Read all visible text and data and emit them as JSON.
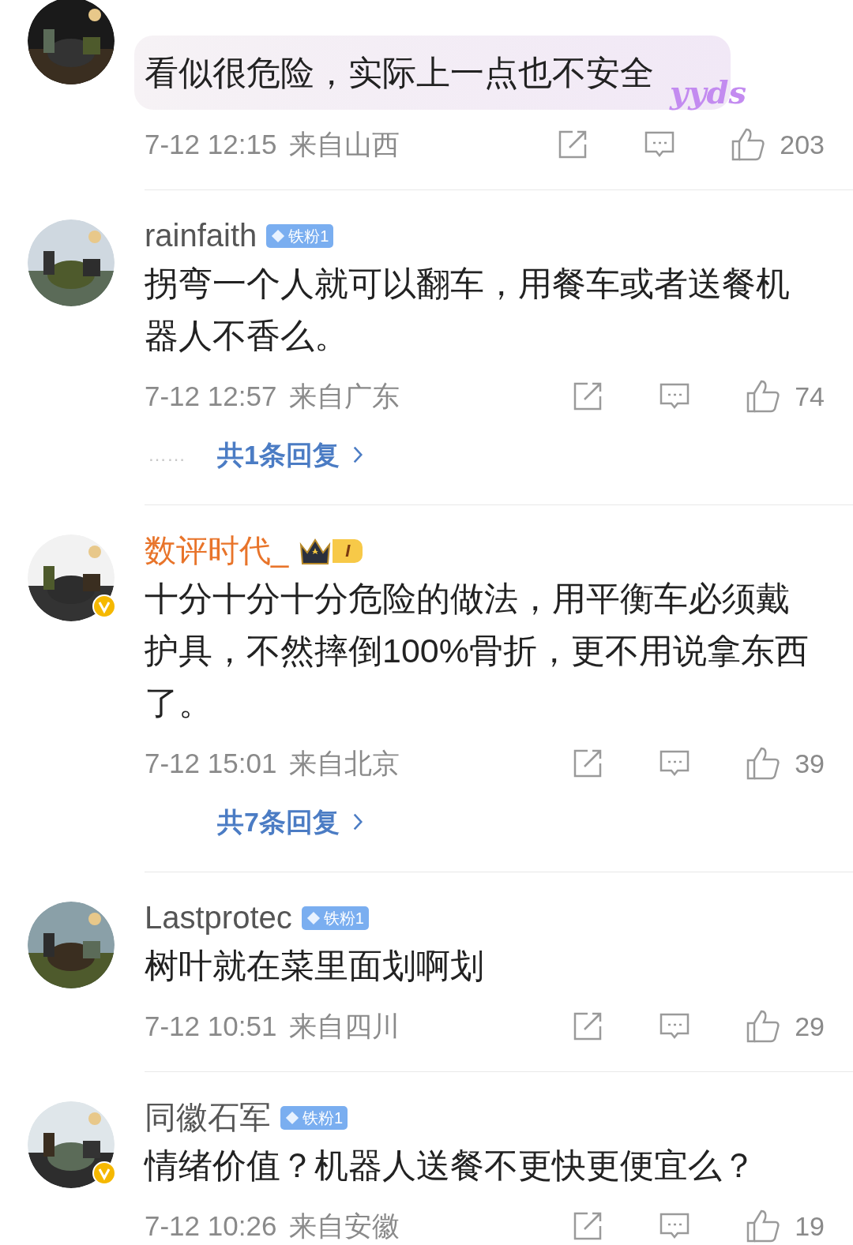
{
  "comments": [
    {
      "avatar": {
        "kind": "picture",
        "verified": false
      },
      "lines": [
        "看似很危险，实际上一点也不安全"
      ],
      "bubble": true,
      "sticker": "yyds",
      "time": "7-12 12:15",
      "location": "来自山西",
      "likes": "203"
    },
    {
      "avatar": {
        "kind": "picture",
        "verified": false
      },
      "name": "rainfaith",
      "vip": false,
      "badge": {
        "kind": "fan",
        "label": "铁粉1"
      },
      "lines": [
        "拐弯一个人就可以翻车，用餐车或者送餐机",
        "器人不香么。"
      ],
      "bubble": false,
      "time": "7-12 12:57",
      "location": "来自广东",
      "likes": "74",
      "replies": {
        "dots": "……",
        "label": "共1条回复"
      }
    },
    {
      "avatar": {
        "kind": "picture",
        "verified": true
      },
      "name": "数评时代_",
      "vip": true,
      "badge": {
        "kind": "crown",
        "label": "I"
      },
      "lines": [
        "十分十分十分危险的做法，用平衡车必须戴",
        "护具，不然摔倒100%骨折，更不用说拿东西",
        "了。"
      ],
      "bubble": false,
      "time": "7-12 15:01",
      "location": "来自北京",
      "likes": "39",
      "replies": {
        "label": "共7条回复"
      }
    },
    {
      "avatar": {
        "kind": "picture",
        "verified": false
      },
      "name": "Lastprotec",
      "vip": false,
      "badge": {
        "kind": "fan",
        "label": "铁粉1"
      },
      "lines": [
        "树叶就在菜里面划啊划"
      ],
      "bubble": false,
      "time": "7-12 10:51",
      "location": "来自四川",
      "likes": "29"
    },
    {
      "avatar": {
        "kind": "picture",
        "verified": true
      },
      "name": "同徽石军",
      "vip": false,
      "badge": {
        "kind": "fan",
        "label": "铁粉1"
      },
      "lines": [
        "情绪价值？机器人送餐不更快更便宜么？"
      ],
      "bubble": false,
      "time": "7-12 10:26",
      "location": "来自安徽",
      "likes": "19"
    }
  ]
}
